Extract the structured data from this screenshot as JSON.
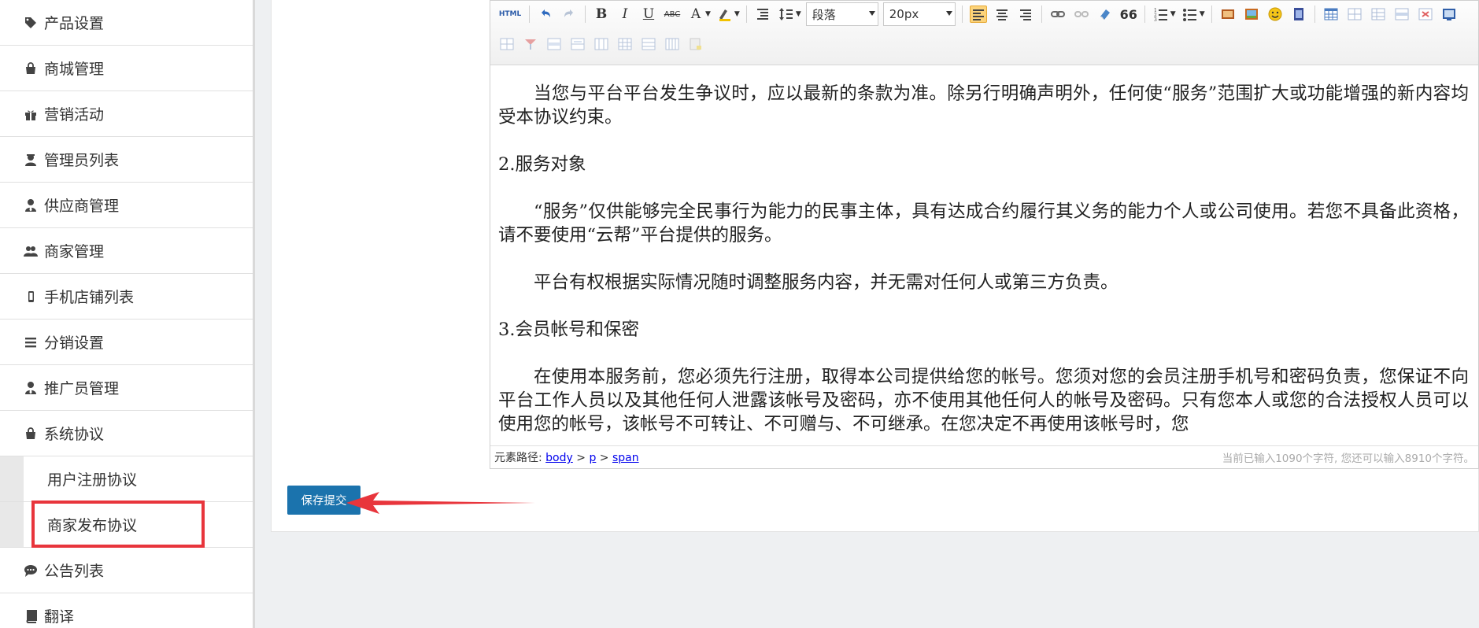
{
  "sidebar": {
    "items": [
      {
        "label": "产品设置",
        "icon": "tag-icon"
      },
      {
        "label": "商城管理",
        "icon": "shopping-bag-icon"
      },
      {
        "label": "营销活动",
        "icon": "gift-icon"
      },
      {
        "label": "管理员列表",
        "icon": "user-secret-icon"
      },
      {
        "label": "供应商管理",
        "icon": "user-tie-icon"
      },
      {
        "label": "商家管理",
        "icon": "users-icon"
      },
      {
        "label": "手机店铺列表",
        "icon": "mobile-icon"
      },
      {
        "label": "分销设置",
        "icon": "bars-icon"
      },
      {
        "label": "推广员管理",
        "icon": "user-tie-icon"
      },
      {
        "label": "系统协议",
        "icon": "shopping-bag-icon"
      }
    ],
    "sub_items": [
      {
        "label": "用户注册协议"
      },
      {
        "label": "商家发布协议"
      }
    ],
    "bottom_items": [
      {
        "label": "公告列表",
        "icon": "comment-icon"
      },
      {
        "label": "翻译",
        "icon": "book-icon"
      }
    ]
  },
  "toolbar": {
    "html_label": "HTML",
    "bold": "B",
    "italic": "I",
    "underline": "U",
    "strike": "ABC",
    "font_color": "A",
    "paragraph_select": "段落",
    "font_size_select": "20px",
    "blockquote": "66"
  },
  "editor": {
    "paragraphs": [
      {
        "text": "当您与平台平台发生争议时，应以最新的条款为准。除另行明确声明外，任何使“服务”范围扩大或功能增强的新内容均受本协议约束。",
        "indent": true
      },
      {
        "text": "2.服务对象",
        "indent": false
      },
      {
        "text": "“服务”仅供能够完全民事行为能力的民事主体，具有达成合约履行其义务的能力个人或公司使用。若您不具备此资格，请不要使用“云帮”平台提供的服务。",
        "indent": true
      },
      {
        "text": "平台有权根据实际情况随时调整服务内容，并无需对任何人或第三方负责。",
        "indent": true
      },
      {
        "text": "3.会员帐号和保密",
        "indent": false
      },
      {
        "text": "在使用本服务前，您必须先行注册，取得本公司提供给您的帐号。您须对您的会员注册手机号和密码负责，您保证不向平台工作人员以及其他任何人泄露该帐号及密码，亦不使用其他任何人的帐号及密码。只有您本人或您的合法授权人员可以使用您的帐号，该帐号不可转让、不可赠与、不可继承。在您决定不再使用该帐号时，您",
        "indent": true
      }
    ],
    "status": {
      "path_label": "元素路径:",
      "path": [
        "body",
        "p",
        "span"
      ],
      "path_sep": ">",
      "char_count": "当前已输入1090个字符, 您还可以输入8910个字符。"
    }
  },
  "actions": {
    "save_label": "保存提交"
  },
  "colors": {
    "accent": "#1b73ad",
    "highlight": "#e8353c"
  }
}
